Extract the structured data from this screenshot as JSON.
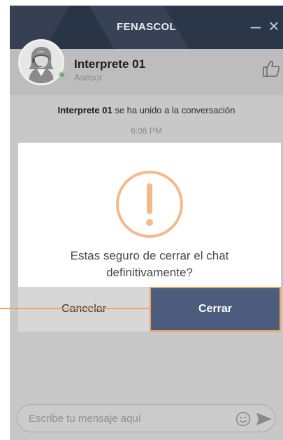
{
  "header": {
    "title": "FENASCOL",
    "minimize_glyph": "–",
    "close_glyph": "×"
  },
  "agent": {
    "name": "Interprete 01",
    "role": "Asesor",
    "status": "online",
    "status_color": "#5cb85c"
  },
  "conversation": {
    "system_name": "Interprete 01",
    "system_text": " se ha unido a la conversación",
    "time": "6:06 PM"
  },
  "dialog": {
    "message": "Estas seguro de cerrar el chat definitivamente?",
    "cancel_label": "Cancelar",
    "confirm_label": "Cerrar",
    "icon": "exclamation-circle-icon",
    "accent_color": "#f2a25b",
    "confirm_color": "#4c5c7c"
  },
  "composer": {
    "placeholder": "Escribe tu mensaje aquí"
  }
}
